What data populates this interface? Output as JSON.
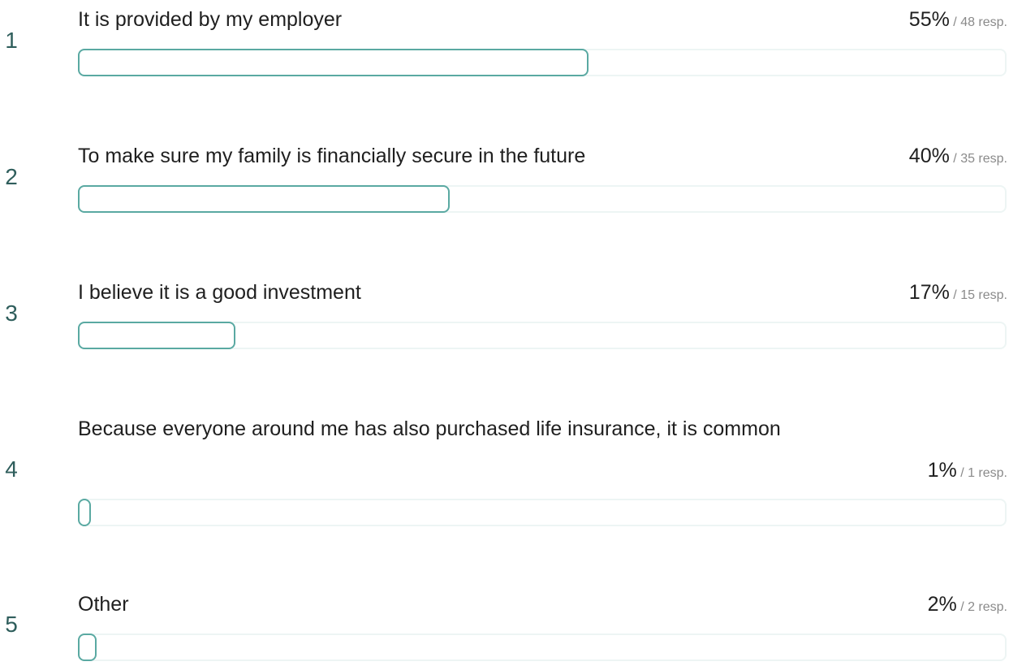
{
  "chart_data": {
    "type": "bar",
    "orientation": "horizontal",
    "categories": [
      "It is provided by my employer",
      "To make sure my family is financially secure in the future",
      "I believe it is a good investment",
      "Because everyone around me has also purchased life insurance, it is common",
      "Other"
    ],
    "values": [
      55,
      40,
      17,
      1,
      2
    ],
    "responses": [
      48,
      35,
      15,
      1,
      2
    ],
    "xlim": [
      0,
      100
    ],
    "grid": false,
    "legend": "none"
  },
  "items": [
    {
      "rank": "1",
      "label": "It is provided by my employer",
      "percent_text": "55%",
      "responses_text": "/ 48 resp."
    },
    {
      "rank": "2",
      "label": "To make sure my family is financially secure in the future",
      "percent_text": "40%",
      "responses_text": "/ 35 resp."
    },
    {
      "rank": "3",
      "label": "I believe it is a good investment",
      "percent_text": "17%",
      "responses_text": "/ 15 resp."
    },
    {
      "rank": "4",
      "label": "Because everyone around me has also purchased life insurance, it is common",
      "percent_text": "1%",
      "responses_text": "/ 1 resp."
    },
    {
      "rank": "5",
      "label": "Other",
      "percent_text": "2%",
      "responses_text": "/ 2 resp."
    }
  ],
  "colors": {
    "bar_outline": "#5aa9a2",
    "track_outline": "#edf5f4",
    "rank_text": "#2f5e5c",
    "secondary_text": "#8a8a8a"
  }
}
